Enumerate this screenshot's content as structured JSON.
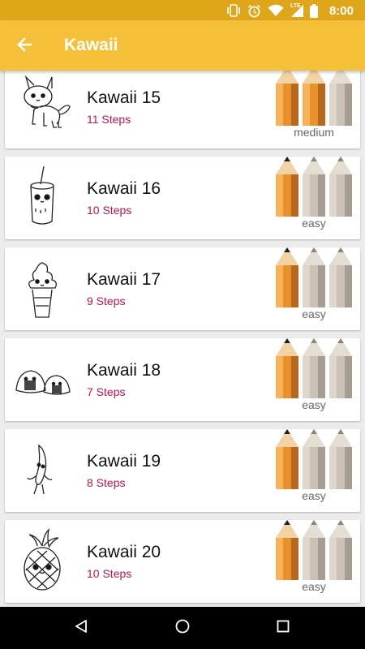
{
  "status_bar": {
    "time": "8:00",
    "network_label": "LTE",
    "icons": [
      "vibrate-icon",
      "alarm-icon",
      "wifi-icon",
      "cell-signal-icon",
      "battery-icon"
    ]
  },
  "app_bar": {
    "title": "Kawaii",
    "back_icon": "arrow-back-icon",
    "background_color": "#f4c03a"
  },
  "colors": {
    "steps_text": "#c0124a",
    "pencil_filled": "#e8902a",
    "pencil_empty": "#c9c1b6",
    "status_bar": "#e0a61a"
  },
  "items": [
    {
      "title": "Kawaii 15",
      "steps": "11 Steps",
      "difficulty": "medium",
      "difficulty_level": 2,
      "max_level": 3,
      "thumbnail": "dog-drawing"
    },
    {
      "title": "Kawaii 16",
      "steps": "10 Steps",
      "difficulty": "easy",
      "difficulty_level": 1,
      "max_level": 3,
      "thumbnail": "bubble-tea-drawing"
    },
    {
      "title": "Kawaii 17",
      "steps": "9 Steps",
      "difficulty": "easy",
      "difficulty_level": 1,
      "max_level": 3,
      "thumbnail": "ice-cream-drawing"
    },
    {
      "title": "Kawaii 18",
      "steps": "7 Steps",
      "difficulty": "easy",
      "difficulty_level": 1,
      "max_level": 3,
      "thumbnail": "rice-balls-drawing"
    },
    {
      "title": "Kawaii 19",
      "steps": "8 Steps",
      "difficulty": "easy",
      "difficulty_level": 1,
      "max_level": 3,
      "thumbnail": "banana-drawing"
    },
    {
      "title": "Kawaii 20",
      "steps": "10 Steps",
      "difficulty": "easy",
      "difficulty_level": 1,
      "max_level": 3,
      "thumbnail": "pineapple-drawing"
    }
  ],
  "nav_bar": {
    "icons": [
      "nav-back-icon",
      "nav-home-icon",
      "nav-recents-icon"
    ]
  }
}
